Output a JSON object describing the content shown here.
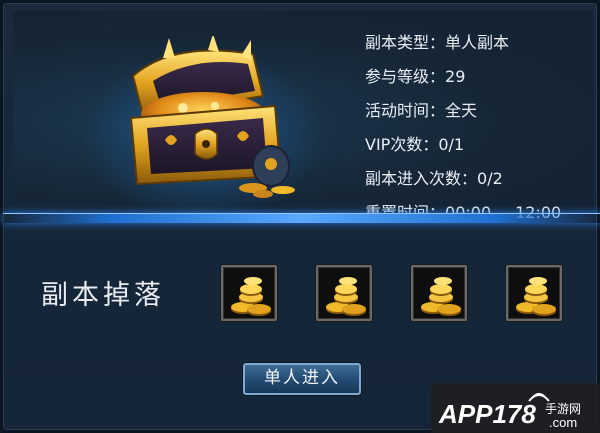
{
  "dungeon": {
    "type_label": "副本类型：",
    "type_value": "单人副本",
    "level_label": "参与等级：",
    "level_value": "29",
    "time_label": "活动时间：",
    "time_value": "全天",
    "vip_label": "VIP次数：",
    "vip_value": "0/1",
    "entries_label": "副本进入次数：",
    "entries_value": "0/2",
    "reset_label": "重置时间：",
    "reset_times": [
      "00:00",
      "12:00"
    ]
  },
  "drops": {
    "label": "副本掉落",
    "items": [
      {
        "icon": "gold-coins-icon"
      },
      {
        "icon": "gold-coins-icon"
      },
      {
        "icon": "gold-coins-icon"
      },
      {
        "icon": "gold-coins-icon"
      }
    ]
  },
  "actions": {
    "enter_label": "单人进入"
  },
  "watermark": {
    "text": "APP178",
    "sub_cn": "手游网",
    "sub_en": ".com"
  },
  "colors": {
    "panel_bg": "#17273a",
    "divider_glow": "#5aa8ff",
    "button_blue": "#244d74",
    "gold": "#f0b92a"
  }
}
